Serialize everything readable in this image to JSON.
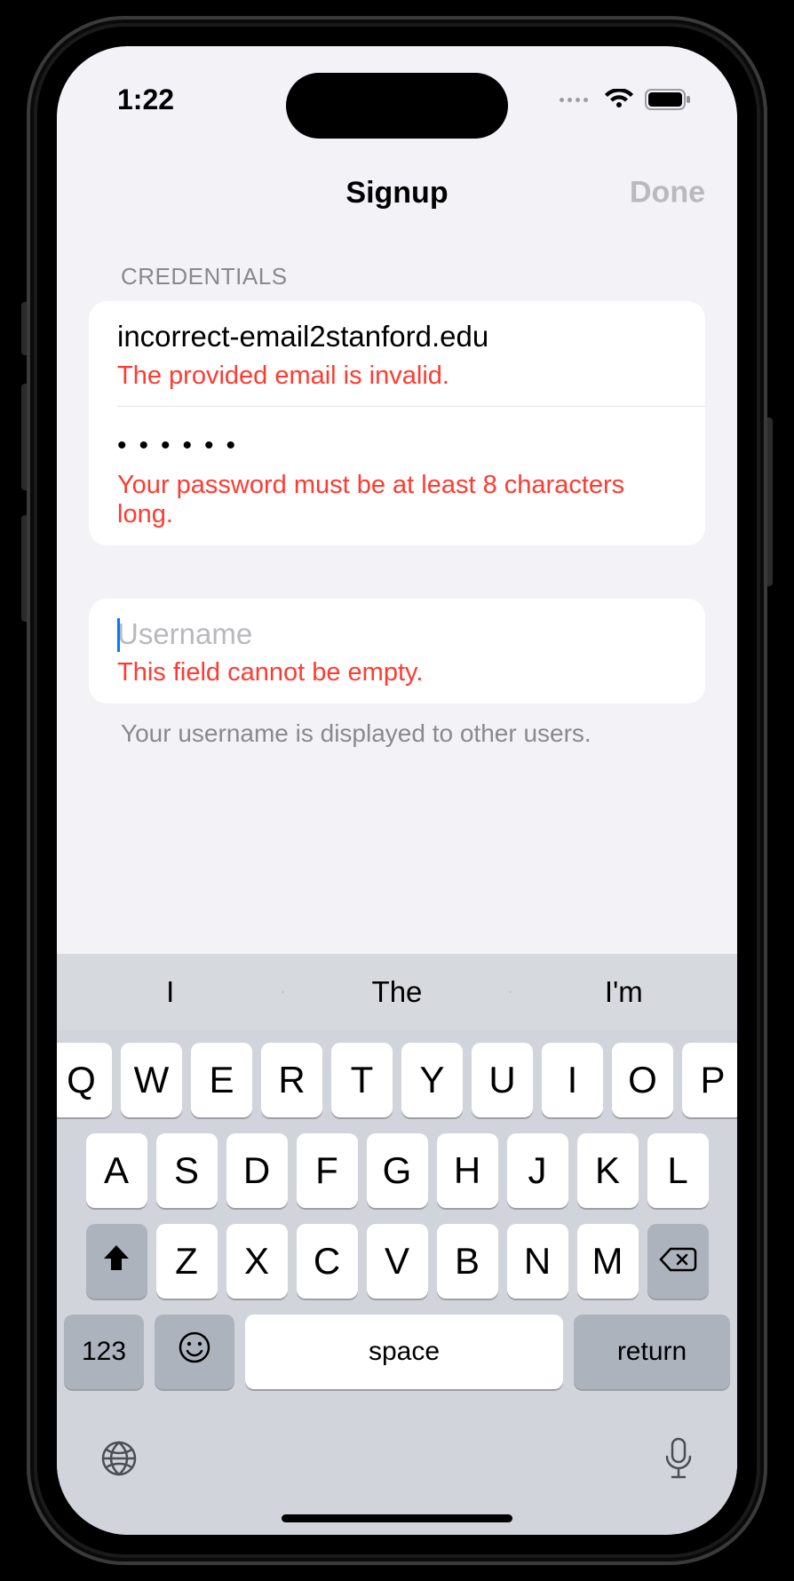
{
  "status": {
    "time": "1:22"
  },
  "nav": {
    "title": "Signup",
    "done": "Done"
  },
  "section1": {
    "header": "CREDENTIALS",
    "email": {
      "value": "incorrect-email2stanford.edu",
      "error": "The provided email is invalid."
    },
    "password": {
      "masked": "••••••",
      "error": "Your password must be at least 8 characters long."
    }
  },
  "section2": {
    "username": {
      "placeholder": "Username",
      "error": "This field cannot be empty."
    },
    "footer": "Your username is displayed to other users."
  },
  "keyboard": {
    "suggestions": [
      "I",
      "The",
      "I'm"
    ],
    "row1": [
      "Q",
      "W",
      "E",
      "R",
      "T",
      "Y",
      "U",
      "I",
      "O",
      "P"
    ],
    "row2": [
      "A",
      "S",
      "D",
      "F",
      "G",
      "H",
      "J",
      "K",
      "L"
    ],
    "row3": [
      "Z",
      "X",
      "C",
      "V",
      "B",
      "N",
      "M"
    ],
    "k123": "123",
    "space": "space",
    "ret": "return"
  }
}
